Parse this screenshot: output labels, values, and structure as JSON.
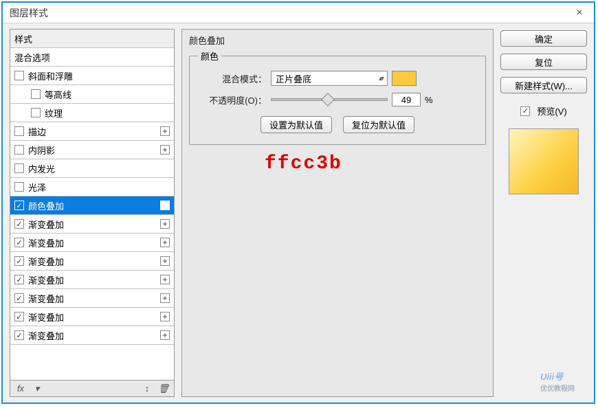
{
  "window": {
    "title": "图层样式"
  },
  "left": {
    "header": "样式",
    "items": [
      {
        "label": "混合选项",
        "checkbox": false,
        "checked": false,
        "indent": false,
        "plus": false
      },
      {
        "label": "斜面和浮雕",
        "checkbox": true,
        "checked": false,
        "indent": false,
        "plus": false
      },
      {
        "label": "等高线",
        "checkbox": true,
        "checked": false,
        "indent": true,
        "plus": false
      },
      {
        "label": "纹理",
        "checkbox": true,
        "checked": false,
        "indent": true,
        "plus": false
      },
      {
        "label": "描边",
        "checkbox": true,
        "checked": false,
        "indent": false,
        "plus": true
      },
      {
        "label": "内阴影",
        "checkbox": true,
        "checked": false,
        "indent": false,
        "plus": true
      },
      {
        "label": "内发光",
        "checkbox": true,
        "checked": false,
        "indent": false,
        "plus": false
      },
      {
        "label": "光泽",
        "checkbox": true,
        "checked": false,
        "indent": false,
        "plus": false
      },
      {
        "label": "颜色叠加",
        "checkbox": true,
        "checked": true,
        "indent": false,
        "plus": true,
        "selected": true
      },
      {
        "label": "渐变叠加",
        "checkbox": true,
        "checked": true,
        "indent": false,
        "plus": true
      },
      {
        "label": "渐变叠加",
        "checkbox": true,
        "checked": true,
        "indent": false,
        "plus": true
      },
      {
        "label": "渐变叠加",
        "checkbox": true,
        "checked": true,
        "indent": false,
        "plus": true
      },
      {
        "label": "渐变叠加",
        "checkbox": true,
        "checked": true,
        "indent": false,
        "plus": true
      },
      {
        "label": "渐变叠加",
        "checkbox": true,
        "checked": true,
        "indent": false,
        "plus": true
      },
      {
        "label": "渐变叠加",
        "checkbox": true,
        "checked": true,
        "indent": false,
        "plus": true
      },
      {
        "label": "渐变叠加",
        "checkbox": true,
        "checked": true,
        "indent": false,
        "plus": true
      }
    ],
    "fx_label": "fx"
  },
  "center": {
    "section_title": "颜色叠加",
    "group_legend": "颜色",
    "blend_label": "混合模式：",
    "blend_value": "正片叠底",
    "opacity_label": "不透明度(O)：",
    "opacity_value": "49",
    "opacity_unit": "%",
    "default_btn": "设置为默认值",
    "reset_btn": "复位为默认值",
    "code_text": "ffcc3b",
    "swatch_color": "#ffc93b"
  },
  "right": {
    "ok": "确定",
    "cancel": "复位",
    "newstyle": "新建样式(W)...",
    "preview_label": "预览(V)"
  },
  "watermark": {
    "main": "Uiii号",
    "sub": "优优教程网"
  }
}
